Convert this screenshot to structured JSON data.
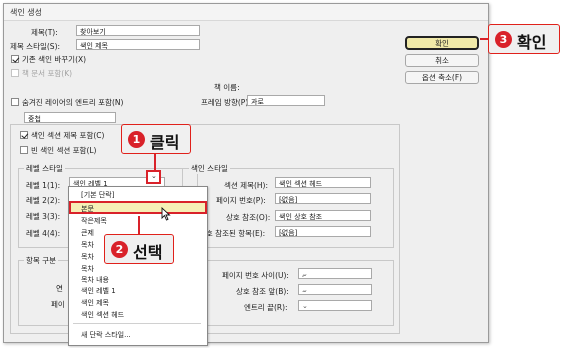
{
  "dialog": {
    "title": "색인 생성",
    "title_field": {
      "label": "제목(T):",
      "value": "찾아보기"
    },
    "title_style": {
      "label": "제목 스타일(S):",
      "value": "색인 제목"
    },
    "replace_existing": {
      "label": "기존 색인 바꾸기(X)",
      "checked": true
    },
    "include_book": {
      "label": "책 문서 포함(K)",
      "checked": false,
      "enabled": false
    },
    "include_hidden": {
      "label": "숨겨진 레이어의 엔트리 포함(N)",
      "checked": false
    },
    "book_name": {
      "label": "책 이름:"
    },
    "frame_direction": {
      "label": "프레임 방향(P):",
      "value": "가로"
    },
    "type_select": {
      "value": "중첩"
    },
    "include_section_headings": {
      "label": "색인 섹션 제목 포함(C)",
      "checked": true
    },
    "include_empty_sections": {
      "label": "빈 색인 섹션 포함(L)",
      "checked": false
    },
    "level_style": {
      "title": "레벨 스타일",
      "levels": [
        {
          "label": "레벨 1(1):",
          "value": "색인 레벨 1"
        },
        {
          "label": "레벨 2(2):",
          "value": "[기본 단락]"
        },
        {
          "label": "레벨 3(3):",
          "value": ""
        },
        {
          "label": "레벨 4(4):",
          "value": ""
        }
      ]
    },
    "index_style": {
      "title": "색인 스타일",
      "rows": [
        {
          "label": "섹션 제목(H):",
          "value": "색인 섹션 헤드"
        },
        {
          "label": "페이지 번호(P):",
          "value": "[없음]"
        },
        {
          "label": "상호 참조(O):",
          "value": "색인 상호 참조"
        },
        {
          "label": "상호 참조된 항목(E):",
          "value": "[없음]"
        }
      ]
    },
    "separators": {
      "title": "항목 구분",
      "partial_left1": "연",
      "partial_left2": "페이",
      "rows": [
        {
          "label": "페이지 번호 사이(U):",
          "value": ","
        },
        {
          "label": "상호 참조 앞(B):",
          "value": "."
        },
        {
          "label": "엔트리 끝(R):",
          "value": ""
        }
      ]
    },
    "buttons": {
      "ok": "확인",
      "cancel": "취소",
      "fewer_options": "옵션 축소(F)"
    }
  },
  "dropdown": {
    "items": [
      "[기본 단락]",
      "본문",
      "작은제목",
      "큰제",
      "목차",
      "목차",
      "목차",
      "목차 내용",
      "색인 레벨 1",
      "색인 제목",
      "색인 섹션 헤드"
    ],
    "new_style": "새 단락 스타일...",
    "highlighted_index": 1
  },
  "annotations": {
    "step1": {
      "number": "1",
      "text": "클릭"
    },
    "step2": {
      "number": "2",
      "text": "선택"
    },
    "step3": {
      "number": "3",
      "text": "확인"
    },
    "accent_color": "#d9222a",
    "button_highlight_color": "#f0e9a8"
  }
}
